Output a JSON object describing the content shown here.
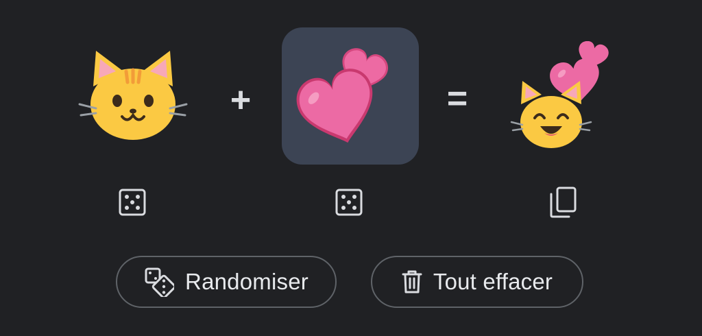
{
  "mixer": {
    "left_emoji": {
      "name": "cat-face-icon"
    },
    "operator_plus": "+",
    "middle_emoji": {
      "name": "two-hearts-icon",
      "selected": true
    },
    "operator_equals": "=",
    "result_emoji": {
      "name": "grinning-cat-with-hearts-icon"
    }
  },
  "controls": {
    "left_dice": {
      "icon": "dice-icon"
    },
    "middle_dice": {
      "icon": "dice-icon"
    },
    "copy": {
      "icon": "copy-icon"
    }
  },
  "actions": {
    "randomize_label": "Randomiser",
    "randomize_icon": "dice-pair-icon",
    "clear_label": "Tout effacer",
    "clear_icon": "trash-icon"
  },
  "colors": {
    "background": "#202124",
    "selected_tile": "#3c4454",
    "outline": "#5f6368",
    "text": "#e8eaed",
    "emoji_yellow": "#fbc943",
    "heart_pink": "#e35b97"
  }
}
